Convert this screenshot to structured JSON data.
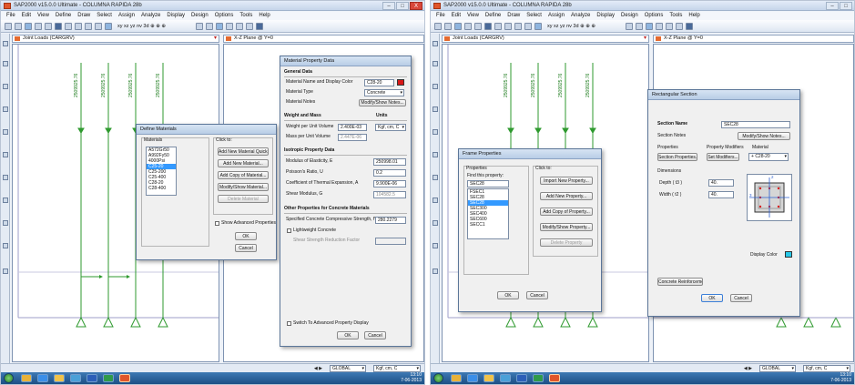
{
  "app": {
    "title": "SAP2000 v15.0.0 Ultimate - COLUMNA RAPIDA 28b",
    "window_controls": [
      "–",
      "□",
      "X"
    ],
    "menu": [
      "File",
      "Edit",
      "View",
      "Define",
      "Draw",
      "Select",
      "Assign",
      "Analyze",
      "Display",
      "Design",
      "Options",
      "Tools",
      "Help"
    ],
    "toolbar_text": "xy xz yz nv 3d ⊕ ⊕ ⊕",
    "view_left_tab": "Joint Loads (CARGRV)",
    "view_right_tab": "X-Z Plane @ Y=0",
    "joint_load_labels": [
      "2509925.76",
      "2509925.76",
      "2509925.76",
      "2509925.76"
    ],
    "status_coord": "GLOBAL",
    "status_units": "Kgf, cm, C",
    "clock_time": "13:10",
    "clock_date": "7-06-2013",
    "colors": {
      "accent": "#3399ff",
      "titlebar": "#c5d5ea",
      "taskbar": "#1d4f85",
      "load_arrow": "#2f9a2f",
      "material_color": "#d81818",
      "display_color": "#27c8e8",
      "rebar": "#d81818"
    }
  },
  "define_materials": {
    "title": "Define Materials",
    "materials_label": "Materials",
    "click_label": "Click to:",
    "materials": [
      "A572Gr50",
      "A992Fy50",
      "4000Psi",
      "C25-20",
      "C25-200",
      "C25-400",
      "C28-20",
      "C28-400"
    ],
    "selected_index": 3,
    "buttons": [
      "Add New Material Quick...",
      "Add New Material...",
      "Add Copy of Material...",
      "Modify/Show Material...",
      "Delete Material"
    ],
    "show_advanced": "Show Advanced Properties",
    "ok": "OK",
    "cancel": "Cancel"
  },
  "material_property": {
    "title": "Material Property Data",
    "general_data": "General Data",
    "name_label": "Material Name and Display Color",
    "name_value": "C28-20",
    "type_label": "Material Type",
    "type_value": "Concrete",
    "notes_label": "Material Notes",
    "notes_button": "Modify/Show Notes...",
    "weight_mass": "Weight and Mass",
    "units_label": "Units",
    "weight_label": "Weight per Unit Volume",
    "weight_value": "2.400E-03",
    "units_value": "Kgf, cm, C",
    "mass_label": "Mass per Unit Volume",
    "mass_value": "2.447E-06",
    "isotropic": "Isotropic Property Data",
    "modulus_label": "Modulus of Elasticity, E",
    "modulus_value": "250998.01",
    "poisson_label": "Poisson's Ratio, U",
    "poisson_value": "0.2",
    "thermal_label": "Coefficient of Thermal Expansion, A",
    "thermal_value": "9.900E-06",
    "shear_label": "Shear Modulus, G",
    "shear_value": "104582.5",
    "other_props": "Other Properties for Concrete Materials",
    "fc_label": "Specified Concrete Compressive Strength, f'c",
    "fc_value": "280.2279",
    "lightweight": "Lightweight Concrete",
    "shear_reduction": "Shear Strength Reduction Factor",
    "advanced_switch": "Switch To Advanced Property Display",
    "ok": "OK",
    "cancel": "Cancel"
  },
  "frame_properties": {
    "title": "Frame Properties",
    "properties_label": "Properties",
    "find_label": "Find this property:",
    "find_value": "SEC28",
    "click_label": "Click to:",
    "properties": [
      "FSEC1",
      "SEC28",
      "SEC28",
      "SEC300",
      "SEC400",
      "SEC600",
      "SECC1"
    ],
    "selected_index": 2,
    "buttons": [
      "Import New Property...",
      "Add New Property...",
      "Add Copy of Property...",
      "Modify/Show Property...",
      "Delete Property"
    ],
    "ok": "OK",
    "cancel": "Cancel"
  },
  "rect_section": {
    "title": "Rectangular Section",
    "name_label": "Section Name",
    "name_value": "SEC28",
    "notes_label": "Section Notes",
    "notes_button": "Modify/Show Notes...",
    "properties_label": "Properties",
    "modifiers_label": "Property Modifiers",
    "material_label": "Material",
    "section_props_button": "Section Properties...",
    "set_modifiers_button": "Set Modifiers...",
    "material_value": "C28-20",
    "dimensions_label": "Dimensions",
    "depth_label": "Depth ( t3 )",
    "depth_value": "40.",
    "width_label": "Width ( t2 )",
    "width_value": "40.",
    "display_color_label": "Display Color",
    "axis_labels": [
      "2",
      "3"
    ],
    "reinforcement_button": "Concrete Reinforcement...",
    "ok": "OK",
    "cancel": "Cancel"
  }
}
